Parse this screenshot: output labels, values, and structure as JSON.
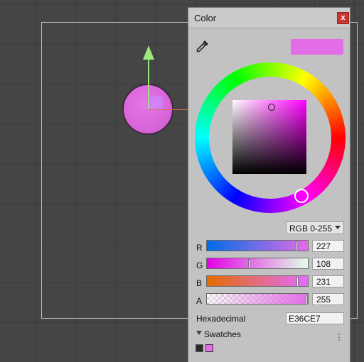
{
  "window": {
    "title": "Color",
    "close_label": "x"
  },
  "color": {
    "hex": "E36CE7",
    "swatch_color": "#E36CE7"
  },
  "mode": {
    "selected": "RGB 0-255"
  },
  "channels": [
    {
      "label": "R",
      "value": "227",
      "fraction": 0.89
    },
    {
      "label": "G",
      "value": "108",
      "fraction": 0.42
    },
    {
      "label": "B",
      "value": "231",
      "fraction": 0.91
    },
    {
      "label": "A",
      "value": "255",
      "fraction": 1.0
    }
  ],
  "hex_field": {
    "label": "Hexadecimal",
    "value": "E36CE7"
  },
  "swatches": {
    "label": "Swatches",
    "menu_icon": "⋮",
    "items": [
      "#2B2B2B",
      "#E36CE7"
    ]
  },
  "icons": {
    "eyedropper": "eyedropper-icon",
    "menu": "kebab-menu-icon",
    "toggle": "triangle-down-icon"
  }
}
